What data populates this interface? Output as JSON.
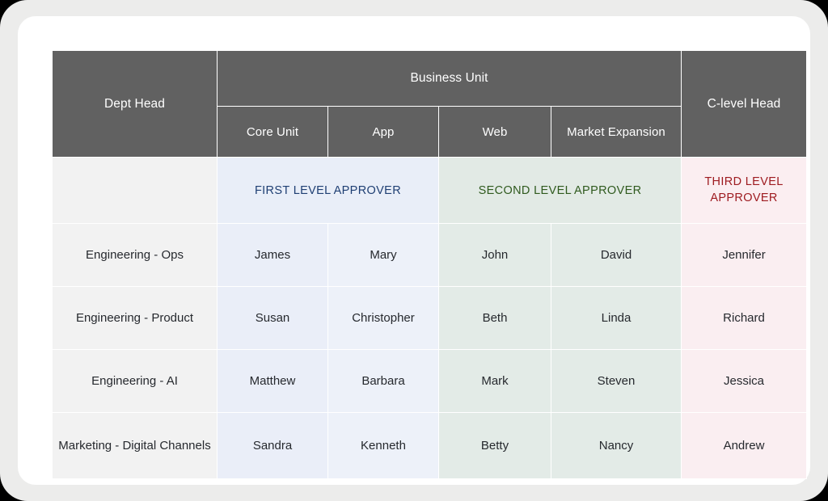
{
  "table": {
    "headers": {
      "dept_head": "Dept Head",
      "business_unit": "Business Unit",
      "c_level_head": "C-level Head",
      "sub_units": [
        "Core Unit",
        "App",
        "Web",
        "Market Expansion"
      ]
    },
    "approver_band": {
      "blank": "",
      "first": "FIRST LEVEL APPROVER",
      "second": "SECOND LEVEL APPROVER",
      "third": "THIRD LEVEL APPROVER"
    },
    "rows": [
      {
        "dept": "Engineering - Ops",
        "core_unit": "James",
        "app": "Mary",
        "web": "John",
        "market_expansion": "David",
        "c_level": "Jennifer"
      },
      {
        "dept": "Engineering - Product",
        "core_unit": "Susan",
        "app": "Christopher",
        "web": "Beth",
        "market_expansion": "Linda",
        "c_level": "Richard"
      },
      {
        "dept": "Engineering - AI",
        "core_unit": "Matthew",
        "app": "Barbara",
        "web": "Mark",
        "market_expansion": "Steven",
        "c_level": "Jessica"
      },
      {
        "dept": "Marketing - Digital Channels",
        "core_unit": "Sandra",
        "app": "Kenneth",
        "web": "Betty",
        "market_expansion": "Nancy",
        "c_level": "Andrew"
      }
    ]
  },
  "colors": {
    "header_bg": "#616161",
    "header_text": "#ffffff",
    "first_level_text": "#1f3f73",
    "second_level_text": "#2f5a1e",
    "third_level_text": "#9e1b20",
    "first_level_bg": "#e9eef8",
    "second_level_bg": "#e2eae5",
    "third_level_bg": "#fbeef1",
    "dept_column_bg": "#f2f2f2",
    "card_bg": "#ffffff",
    "frame_bg": "#ececeb"
  }
}
